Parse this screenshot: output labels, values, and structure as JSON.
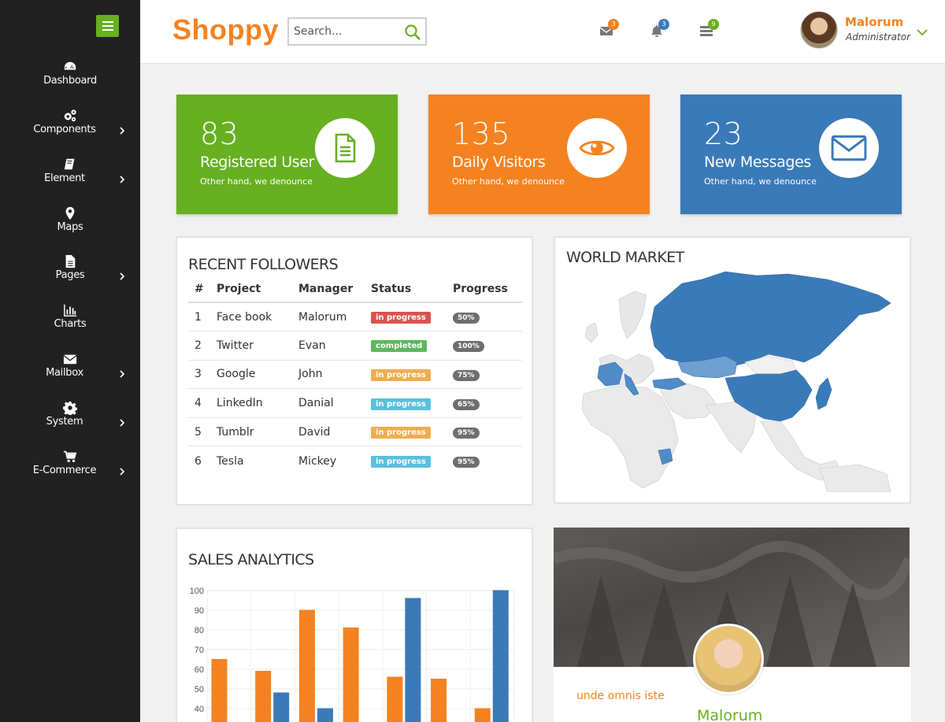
{
  "brand": "Shoppy",
  "search": {
    "placeholder": "Search..."
  },
  "sidebar": {
    "items": [
      {
        "label": "Dashboard",
        "icon": "dashboard-icon",
        "submenu": false
      },
      {
        "label": "Components",
        "icon": "gears-icon",
        "submenu": true
      },
      {
        "label": "Element",
        "icon": "book-icon",
        "submenu": true
      },
      {
        "label": "Maps",
        "icon": "map-marker-icon",
        "submenu": false
      },
      {
        "label": "Pages",
        "icon": "file-icon",
        "submenu": true
      },
      {
        "label": "Charts",
        "icon": "bar-chart-icon",
        "submenu": false
      },
      {
        "label": "Mailbox",
        "icon": "envelope-icon",
        "submenu": true
      },
      {
        "label": "System",
        "icon": "gear-icon",
        "submenu": true
      },
      {
        "label": "E-Commerce",
        "icon": "cart-icon",
        "submenu": true
      }
    ]
  },
  "header": {
    "notifications": [
      {
        "icon": "mail-icon",
        "count": "3",
        "color": "#f58220"
      },
      {
        "icon": "bell-icon",
        "count": "3",
        "color": "#3a7ab8"
      },
      {
        "icon": "tasks-icon",
        "count": "9",
        "color": "#67b021"
      }
    ],
    "user": {
      "name": "Malorum",
      "role": "Administrator"
    }
  },
  "stats": [
    {
      "value": "83",
      "title": "Registered User",
      "subtitle": "Other hand, we denounce",
      "color": "#67b021",
      "icon": "document-icon"
    },
    {
      "value": "135",
      "title": "Daily Visitors",
      "subtitle": "Other hand, we denounce",
      "color": "#f58220",
      "icon": "eye-icon"
    },
    {
      "value": "23",
      "title": "New Messages",
      "subtitle": "Other hand, we denounce",
      "color": "#3a7ab8",
      "icon": "envelope-icon"
    }
  ],
  "followers": {
    "title": "RECENT FOLLOWERS",
    "columns": [
      "#",
      "Project",
      "Manager",
      "Status",
      "Progress"
    ],
    "rows": [
      {
        "num": "1",
        "project": "Face book",
        "manager": "Malorum",
        "status": "in progress",
        "status_color": "#d9534f",
        "progress": "50%"
      },
      {
        "num": "2",
        "project": "Twitter",
        "manager": "Evan",
        "status": "completed",
        "status_color": "#5cb85c",
        "progress": "100%"
      },
      {
        "num": "3",
        "project": "Google",
        "manager": "John",
        "status": "in progress",
        "status_color": "#f0ad4e",
        "progress": "75%"
      },
      {
        "num": "4",
        "project": "LinkedIn",
        "manager": "Danial",
        "status": "in progress",
        "status_color": "#5bc0de",
        "progress": "65%"
      },
      {
        "num": "5",
        "project": "Tumblr",
        "manager": "David",
        "status": "in progress",
        "status_color": "#f0ad4e",
        "progress": "95%"
      },
      {
        "num": "6",
        "project": "Tesla",
        "manager": "Mickey",
        "status": "in progress",
        "status_color": "#5bc0de",
        "progress": "95%"
      }
    ]
  },
  "world_market": {
    "title": "WORLD MARKET"
  },
  "sales": {
    "title": "SALES ANALYTICS"
  },
  "profile": {
    "tag": "unde omnis iste",
    "name": "Malorum"
  },
  "chart_data": {
    "type": "bar",
    "title": "SALES ANALYTICS",
    "ylim": [
      0,
      100
    ],
    "yticks": [
      100,
      90,
      80,
      70,
      60,
      50,
      40
    ],
    "grid": true,
    "series": [
      {
        "color": "#f58220",
        "values": [
          65,
          59,
          90,
          81,
          56,
          55,
          40
        ]
      },
      {
        "color": "#3a7ab8",
        "values": [
          null,
          48,
          40,
          null,
          96,
          null,
          100
        ]
      }
    ]
  }
}
